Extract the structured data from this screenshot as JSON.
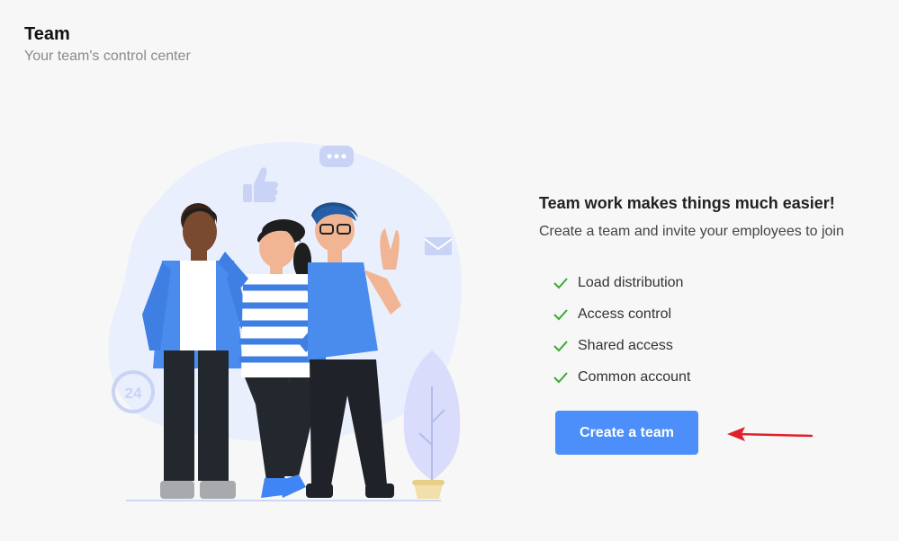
{
  "header": {
    "title": "Team",
    "subtitle": "Your team's control center"
  },
  "promo": {
    "heading": "Team work makes things much easier!",
    "description": "Create a team and invite your employees to join",
    "features": [
      {
        "label": "Load distribution",
        "icon": "check-icon"
      },
      {
        "label": "Access control",
        "icon": "check-icon"
      },
      {
        "label": "Shared access",
        "icon": "check-icon"
      },
      {
        "label": "Common account",
        "icon": "check-icon"
      }
    ],
    "cta_label": "Create a team"
  },
  "illustration": {
    "clock_label": "24"
  },
  "colors": {
    "accent": "#4d8ffa",
    "check": "#3aaa35",
    "annotation": "#e0212b",
    "background": "#f7f7f7"
  }
}
